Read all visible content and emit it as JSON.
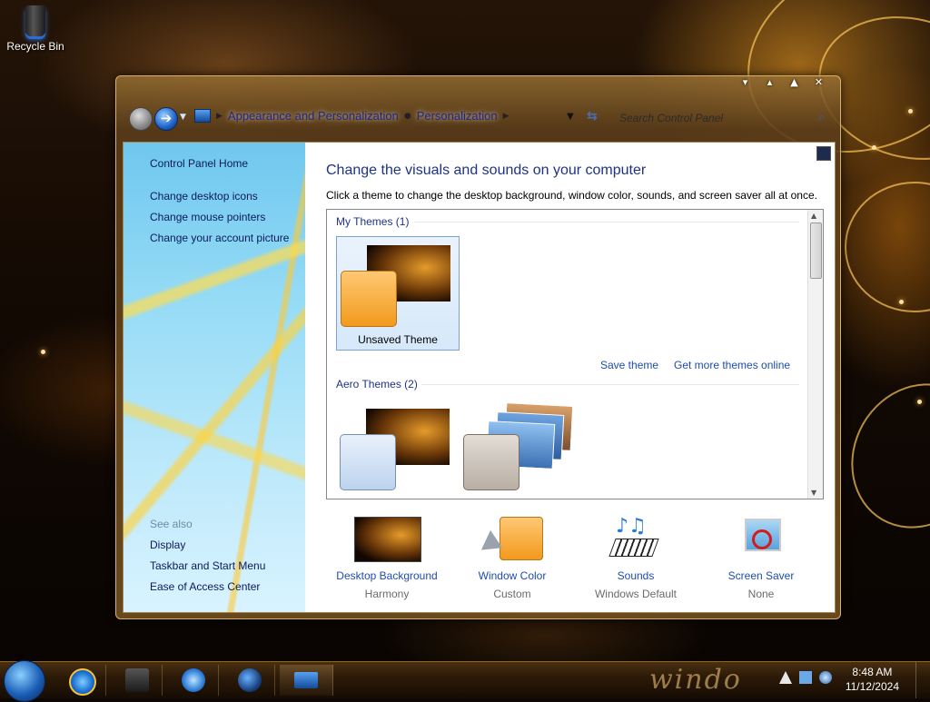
{
  "desktop": {
    "recycle_bin_label": "Recycle Bin"
  },
  "window": {
    "breadcrumbs": [
      "Appearance and Personalization",
      "Personalization"
    ],
    "search_placeholder": "Search Control Panel",
    "caption": {
      "help": "▾",
      "minimize": "▴",
      "maximize": "▲",
      "close": "✕"
    }
  },
  "sidebar": {
    "home": "Control Panel Home",
    "links": [
      "Change desktop icons",
      "Change mouse pointers",
      "Change your account picture"
    ],
    "see_also_title": "See also",
    "see_also": [
      "Display",
      "Taskbar and Start Menu",
      "Ease of Access Center"
    ]
  },
  "main": {
    "title": "Change the visuals and sounds on your computer",
    "description": "Click a theme to change the desktop background, window color, sounds, and screen saver all at once.",
    "my_themes_header": "My Themes (1)",
    "unsaved_theme_label": "Unsaved Theme",
    "save_theme": "Save theme",
    "get_more_themes": "Get more themes online",
    "aero_themes_header": "Aero Themes (2)"
  },
  "bottom": [
    {
      "label": "Desktop Background",
      "value": "Harmony",
      "icon": "desktop-background-icon"
    },
    {
      "label": "Window Color",
      "value": "Custom",
      "icon": "window-color-icon"
    },
    {
      "label": "Sounds",
      "value": "Windows Default",
      "icon": "sounds-icon"
    },
    {
      "label": "Screen Saver",
      "value": "None",
      "icon": "screen-saver-icon"
    }
  ],
  "taskbar": {
    "time": "8:48 AM",
    "date": "11/12/2024",
    "brand_text": "windo"
  },
  "colors": {
    "link": "#1e4cb0",
    "heading": "#1e3287",
    "accent_orange": "#f5a43a"
  }
}
